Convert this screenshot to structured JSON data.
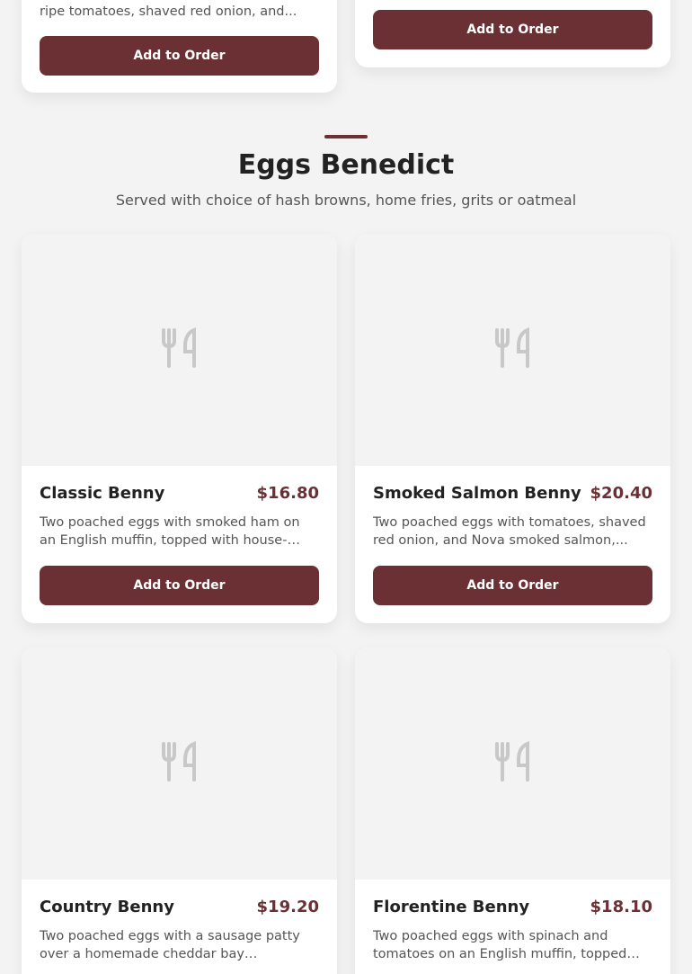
{
  "top_cards": [
    {
      "desc": "ripe tomatoes, shaved red onion, and...",
      "button": "Add to Order"
    },
    {
      "button": "Add to Order"
    }
  ],
  "section": {
    "title": "Eggs Benedict",
    "subtitle": "Served with choice of hash browns, home fries, grits or oatmeal"
  },
  "items": [
    {
      "title": "Classic Benny",
      "price": "$16.80",
      "desc": "Two poached eggs with smoked ham on an English muffin, topped with house-made...",
      "button": "Add to Order",
      "icon": "fork-knife-icon"
    },
    {
      "title": "Smoked Salmon Benny",
      "price": "$20.40",
      "desc": "Two poached eggs with tomatoes, shaved red onion, and Nova smoked salmon,...",
      "button": "Add to Order",
      "icon": "fork-knife-icon"
    },
    {
      "title": "Country Benny",
      "price": "$19.20",
      "desc": "Two poached eggs with a sausage patty over a homemade cheddar bay buttermilk...",
      "button": "Add to Order",
      "icon": "fork-knife-icon"
    },
    {
      "title": "Florentine Benny",
      "price": "$18.10",
      "desc": "Two poached eggs with spinach and tomatoes on an English muffin, topped wit...",
      "button": "Add to Order",
      "icon": "fork-knife-icon"
    }
  ],
  "colors": {
    "accent": "#6b3033",
    "background": "#f3f3f3",
    "card": "#ffffff",
    "icon": "#c8c8c8"
  }
}
